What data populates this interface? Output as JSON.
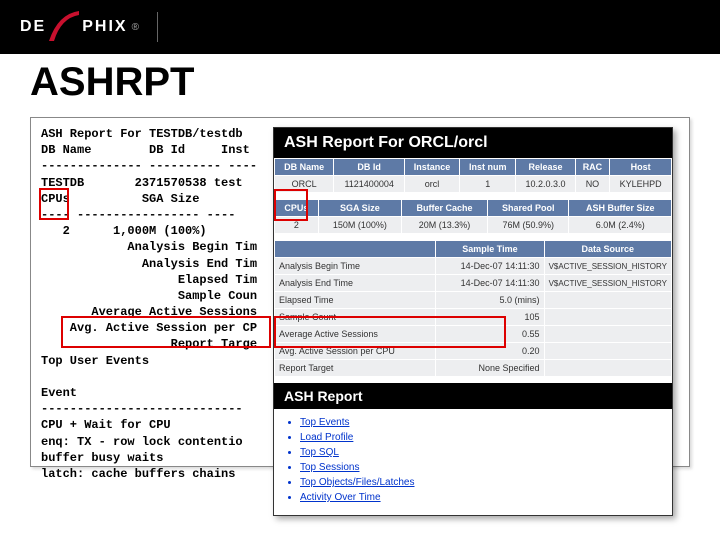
{
  "brand": "DELPHIX",
  "slide_title": "ASHRPT",
  "mono_text": "ASH Report For TESTDB/testdb\nDB Name        DB Id     Inst\n-------------- ---------- ----\nTESTDB       2371570538 test\nCPUs          SGA Size\n---- ----------------- ----\n   2      1,000M (100%)\n            Analysis Begin Tim\n              Analysis End Tim\n                   Elapsed Tim\n                   Sample Coun\n       Average Active Sessions\n    Avg. Active Session per CP\n                  Report Targe\nTop User Events\n\nEvent\n----------------------------\nCPU + Wait for CPU\nenq: TX - row lock contentio\nbuffer busy waits\nlatch: cache buffers chains",
  "overlay": {
    "title": "ASH Report For ORCL/orcl",
    "table1": {
      "headers": [
        "DB Name",
        "DB Id",
        "Instance",
        "Inst num",
        "Release",
        "RAC",
        "Host"
      ],
      "row": [
        "ORCL",
        "1121400004",
        "orcl",
        "1",
        "10.2.0.3.0",
        "NO",
        "KYLEHPD"
      ]
    },
    "table2": {
      "headers": [
        "CPUs",
        "SGA Size",
        "Buffer Cache",
        "Shared Pool",
        "ASH Buffer Size"
      ],
      "row": [
        "2",
        "150M (100%)",
        "20M (13.3%)",
        "76M (50.9%)",
        "6.0M (2.4%)"
      ]
    },
    "table3": {
      "headers": [
        "",
        "Sample Time",
        "Data Source"
      ],
      "rows": [
        [
          "Analysis Begin Time",
          "14-Dec-07 14:11:30",
          "V$ACTIVE_SESSION_HISTORY"
        ],
        [
          "Analysis End Time",
          "14-Dec-07 14:11:30",
          "V$ACTIVE_SESSION_HISTORY"
        ],
        [
          "Elapsed Time",
          "5.0 (mins)",
          ""
        ],
        [
          "Sample Count",
          "105",
          ""
        ],
        [
          "Average Active Sessions",
          "0.55",
          ""
        ],
        [
          "Avg. Active Session per CPU",
          "0.20",
          ""
        ],
        [
          "Report Target",
          "None Specified",
          ""
        ]
      ]
    },
    "subtitle": "ASH Report",
    "links": [
      "Top Events",
      "Load Profile",
      "Top SQL",
      "Top Sessions",
      "Top Objects/Files/Latches",
      "Activity Over Time"
    ]
  }
}
